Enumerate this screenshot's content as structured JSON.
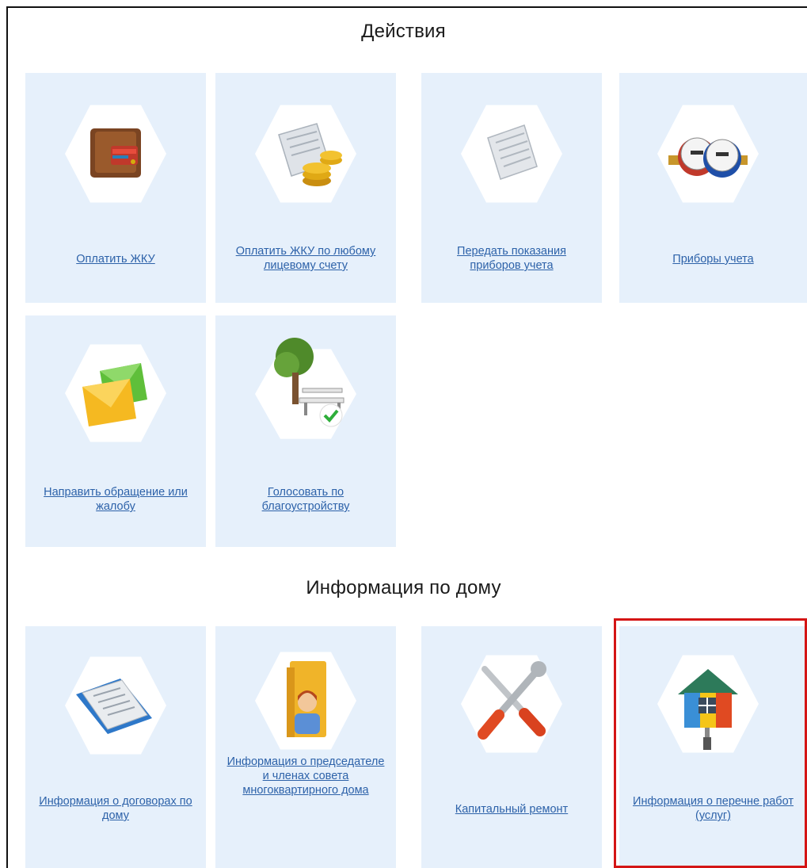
{
  "sections": {
    "actions": {
      "title": "Действия"
    },
    "house_info": {
      "title": "Информация по дому"
    }
  },
  "actions_tiles": [
    {
      "label": "Оплатить ЖКУ",
      "icon": "wallet-icon"
    },
    {
      "label": "Оплатить ЖКУ по любому лицевому счету",
      "icon": "coins-receipt-icon"
    },
    {
      "label": "Передать показания приборов учета",
      "icon": "receipt-icon"
    },
    {
      "label": "Приборы учета",
      "icon": "water-meter-icon"
    },
    {
      "label": "Направить обращение или жалобу",
      "icon": "envelope-icon"
    },
    {
      "label": "Голосовать по благоустройству",
      "icon": "tree-bench-icon"
    }
  ],
  "house_tiles": [
    {
      "label": "Информация о договорах по дому",
      "icon": "documents-icon"
    },
    {
      "label": "Информация о председателе и членах совета многоквартирного дома",
      "icon": "folder-person-icon"
    },
    {
      "label": "Капитальный ремонт",
      "icon": "tools-icon"
    },
    {
      "label": "Информация о перечне работ (услуг)",
      "icon": "house-paint-roller-icon"
    }
  ],
  "colors": {
    "tile_bg": "#e6f0fb",
    "link": "#2d62a9",
    "highlight": "#d41515"
  }
}
